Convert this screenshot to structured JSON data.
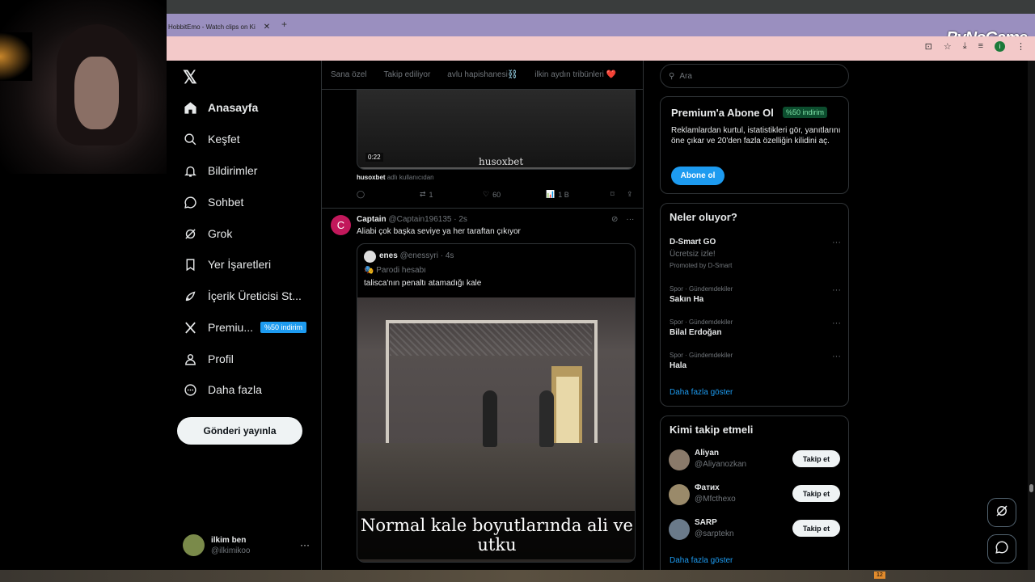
{
  "browser": {
    "tab_title": "HobbitEmo - Watch clips on Ki",
    "tab_close": "✕",
    "tab_new": "+",
    "watermark": "ByNoGame",
    "profile_initial": "i"
  },
  "nav": {
    "items": [
      {
        "label": "Anasayfa"
      },
      {
        "label": "Keşfet"
      },
      {
        "label": "Bildirimler"
      },
      {
        "label": "Sohbet"
      },
      {
        "label": "Grok"
      },
      {
        "label": "Yer İşaretleri"
      },
      {
        "label": "İçerik Üreticisi St..."
      },
      {
        "label": "Premiu...",
        "badge": "%50 indirim"
      },
      {
        "label": "Profil"
      },
      {
        "label": "Daha fazla"
      }
    ],
    "post_button": "Gönderi yayınla",
    "account": {
      "name": "ilkim ben",
      "handle": "@ilkimikoo",
      "more": "···"
    }
  },
  "feed": {
    "tabs": [
      "Sana özel",
      "Takip ediliyor",
      "avlu hapishanesi⛓️",
      "ilkin aydın tribünleri ❤️"
    ],
    "prev_post": {
      "video_time": "0:22",
      "video_watermark": "husoxbet",
      "via_user": "husoxbet",
      "via_text": "adlı kullanıcıdan",
      "retweets": "1",
      "likes": "60",
      "views": "1 B"
    },
    "post": {
      "avatar_letter": "C",
      "name": "Captain",
      "meta": "@Captain196135 · 2s",
      "text": "Aliabi çok başka seviye ya her taraftan çıkıyor",
      "more": "···",
      "quote": {
        "name": "enes",
        "meta": "@enessyri · 4s",
        "parody": "🎭 Parodi hesabı",
        "text": "talisca'nın penaltı atamadığı kale",
        "caption": "Normal kale boyutlarında ali ve utku"
      }
    }
  },
  "right": {
    "search_placeholder": "Ara",
    "premium": {
      "title": "Premium'a Abone Ol",
      "badge": "%50 indirim",
      "text": "Reklamlardan kurtul, istatistikleri gör, yanıtlarını öne çıkar ve 20'den fazla özelliğin kilidini aç.",
      "button": "Abone ol"
    },
    "trends": {
      "title": "Neler oluyor?",
      "promoted": {
        "title": "D-Smart GO",
        "sub": "Ücretsiz izle!",
        "promo": "Promoted by D-Smart"
      },
      "items": [
        {
          "category": "Spor · Gündemdekiler",
          "title": "Sakın Ha"
        },
        {
          "category": "Spor · Gündemdekiler",
          "title": "Bilal Erdoğan"
        },
        {
          "category": "Spor · Gündemdekiler",
          "title": "Hala"
        }
      ],
      "show_more": "Daha fazla göster",
      "dots": "···"
    },
    "follow": {
      "title": "Kimi takip etmeli",
      "items": [
        {
          "name": "Aliyan",
          "handle": "@Aliyanozkan",
          "button": "Takip et"
        },
        {
          "name": "Фатих",
          "handle": "@Mfcthexo",
          "button": "Takip et"
        },
        {
          "name": "SARP",
          "handle": "@sarptekn",
          "button": "Takip et"
        }
      ],
      "show_more": "Daha fazla göster"
    }
  },
  "taskbar": {
    "tray_badge": "12"
  }
}
